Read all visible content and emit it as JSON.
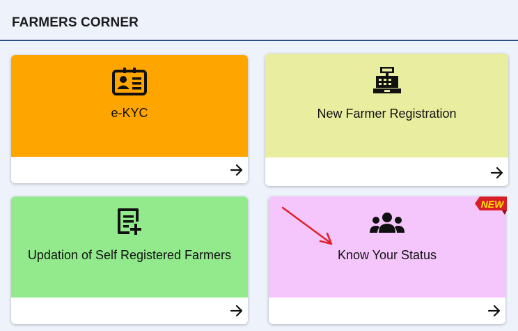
{
  "section": {
    "title": "FARMERS CORNER"
  },
  "cards": [
    {
      "label": "e-KYC",
      "icon": "id-card-icon",
      "bg": "#ffa500"
    },
    {
      "label": "New Farmer Registration",
      "icon": "cash-register-icon",
      "bg": "#e9ed9f"
    },
    {
      "label": "Updation of Self Registered Farmers",
      "icon": "document-add-icon",
      "bg": "#92ea8d"
    },
    {
      "label": "Know Your Status",
      "icon": "group-users-icon",
      "bg": "#f5c6fb"
    }
  ],
  "badge": {
    "text": "NEW"
  },
  "colors": {
    "accent_rule": "#2a4f86",
    "arrow_annotation": "#e0202a",
    "badge_red": "#d81f26",
    "badge_text": "#ffe600"
  }
}
